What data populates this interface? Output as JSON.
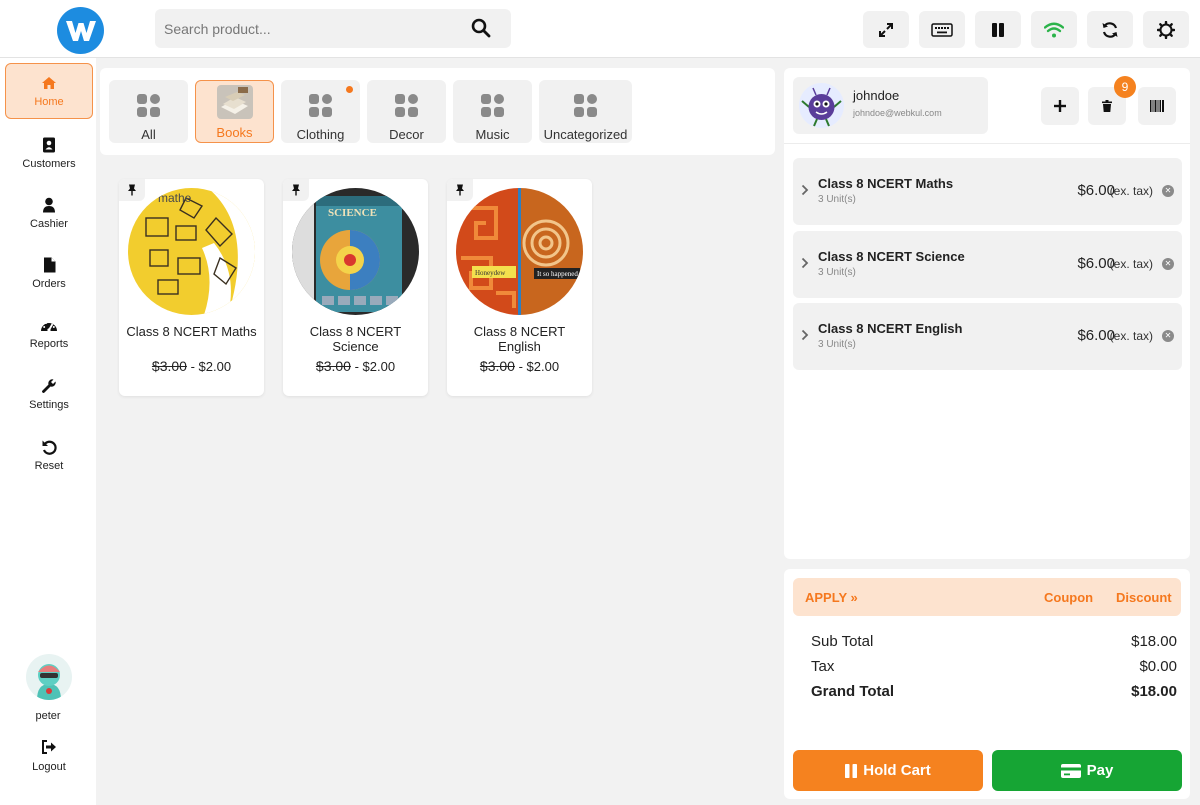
{
  "search": {
    "placeholder": "Search product..."
  },
  "toolbar": {
    "buttons": [
      {
        "icon": "expand-icon"
      },
      {
        "icon": "keyboard-icon"
      },
      {
        "icon": "pause-icon"
      },
      {
        "icon": "wifi-icon"
      },
      {
        "icon": "sync-icon"
      },
      {
        "icon": "gear-icon"
      }
    ],
    "wifi_color": "#2bb34a"
  },
  "sidebar": {
    "items": [
      {
        "label": "Home",
        "icon": "home-icon",
        "active": true
      },
      {
        "label": "Customers",
        "icon": "address-book-icon"
      },
      {
        "label": "Cashier",
        "icon": "user-icon"
      },
      {
        "label": "Orders",
        "icon": "file-icon"
      },
      {
        "label": "Reports",
        "icon": "dashboard-icon"
      },
      {
        "label": "Settings",
        "icon": "wrench-icon"
      },
      {
        "label": "Reset",
        "icon": "undo-icon"
      }
    ],
    "user": {
      "name": "peter"
    },
    "logout_label": "Logout"
  },
  "categories": [
    {
      "label": "All"
    },
    {
      "label": "Books",
      "active": true
    },
    {
      "label": "Clothing",
      "has_dot": true
    },
    {
      "label": "Decor"
    },
    {
      "label": "Music"
    },
    {
      "label": "Uncategorized"
    }
  ],
  "products": [
    {
      "name": "Class 8 NCERT Maths",
      "old_price": "$3.00",
      "separator": " - ",
      "price": "$2.00"
    },
    {
      "name": "Class 8 NCERT Science",
      "old_price": "$3.00",
      "separator": " - ",
      "price": "$2.00"
    },
    {
      "name": "Class 8 NCERT English",
      "old_price": "$3.00",
      "separator": " - ",
      "price": "$2.00"
    }
  ],
  "cart": {
    "customer": {
      "name": "johndoe",
      "email": "johndoe@webkul.com"
    },
    "badge_count": "9",
    "items": [
      {
        "name": "Class 8 NCERT Maths",
        "units": "3 Unit(s)",
        "price": "$6.00",
        "tax_note": "(ex. tax)"
      },
      {
        "name": "Class 8 NCERT Science",
        "units": "3 Unit(s)",
        "price": "$6.00",
        "tax_note": "(ex. tax)"
      },
      {
        "name": "Class 8 NCERT English",
        "units": "3 Unit(s)",
        "price": "$6.00",
        "tax_note": "(ex. tax)"
      }
    ]
  },
  "totals": {
    "apply_label": "APPLY",
    "coupon_label": "Coupon",
    "discount_label": "Discount",
    "sub_total_label": "Sub Total",
    "sub_total": "$18.00",
    "tax_label": "Tax",
    "tax": "$0.00",
    "grand_total_label": "Grand Total",
    "grand_total": "$18.00",
    "hold_label": "Hold Cart",
    "pay_label": "Pay"
  },
  "colors": {
    "accent": "#f5781e",
    "accent_light": "#fde3cf",
    "brand_blue": "#1d8ce0",
    "pay_green": "#16a534"
  }
}
